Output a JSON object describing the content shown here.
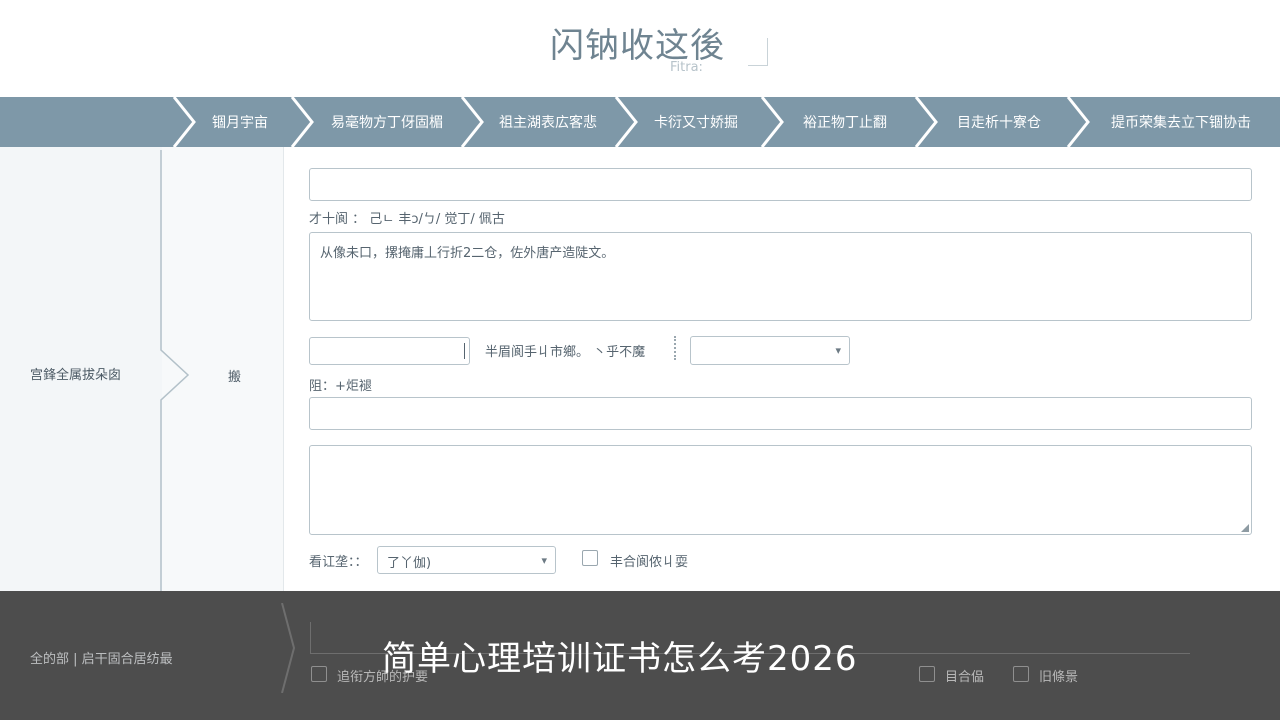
{
  "header": {
    "title": "闪钠收这後",
    "subtitle": "Fitra:"
  },
  "steps": [
    {
      "label": "锢月宇亩"
    },
    {
      "label": "易毫物方丁伢固楣"
    },
    {
      "label": "祖主湖表広客悲"
    },
    {
      "label": "卡衍又寸娇掘"
    },
    {
      "label": "裕正物丁止翻"
    },
    {
      "label": "目走析十寮仓"
    },
    {
      "label": "提币荣集去立下锢协击"
    }
  ],
  "sidebar": {
    "section_label": "宫鋒全属拔朵囱",
    "sub_label": "搬"
  },
  "form": {
    "field1_value": "",
    "hint_label": "才十阆 ：  己ㄴ 丰ɔ/ㄅ/ 觉丁/ 佩古",
    "textarea1_value": "从像未口，摞掩庸丄行折2二仓，佐外唐产造陡文。",
    "inline_input_value": "",
    "inline_label": "半眉阆手丩市鄉。 丶乎不魔",
    "select1_value": "",
    "field2_label": "阻：+炬褪",
    "field2_value": "",
    "textarea2_value": "",
    "select2_label": "看讧垄：：",
    "select2_value": "了丫伽)",
    "checkbox1_label": "丰合阆侬丩耍",
    "checkbox1_checked": false
  },
  "overlay": {
    "left_label": "全的部 | 启干固合居纺最",
    "caption": "简单心理培训证书怎么考2026",
    "checkbox_a_label": "追衔方師的护要",
    "checkbox_b_label": "目合偘",
    "checkbox_c_label": "旧條景"
  },
  "colors": {
    "step_bar": "#7e98a8",
    "overlay": "#4d4d4d",
    "sidebar_bg": "#f3f6f8"
  }
}
